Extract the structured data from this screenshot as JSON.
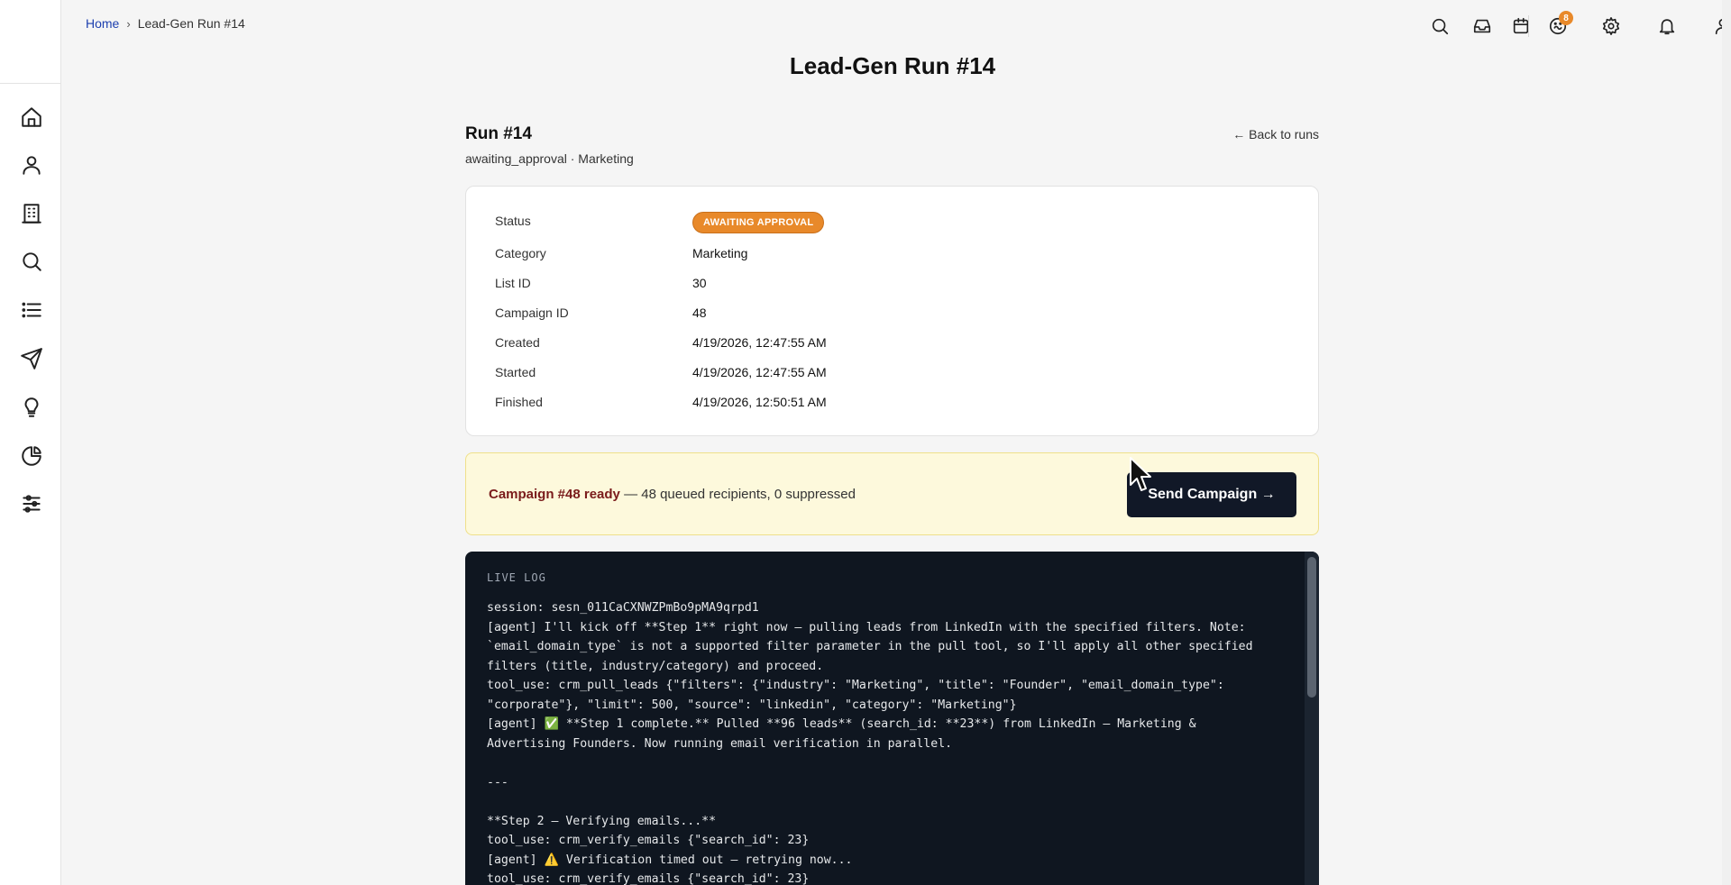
{
  "breadcrumb": {
    "home": "Home",
    "separator": "›",
    "current": "Lead-Gen Run #14"
  },
  "header": {
    "page_title": "Lead-Gen Run #14",
    "notification_count": "8"
  },
  "sidebar": {
    "items": [
      {
        "icon": "home-icon"
      },
      {
        "icon": "user-icon"
      },
      {
        "icon": "building-icon"
      },
      {
        "icon": "search-icon"
      },
      {
        "icon": "list-icon"
      },
      {
        "icon": "send-icon"
      },
      {
        "icon": "lightbulb-icon"
      },
      {
        "icon": "pie-chart-icon"
      },
      {
        "icon": "sliders-icon"
      }
    ]
  },
  "run": {
    "title": "Run #14",
    "subtitle": "awaiting_approval · Marketing",
    "back_label": "← Back to runs"
  },
  "details": {
    "status_label": "Status",
    "status_value": "AWAITING APPROVAL",
    "rows": [
      {
        "label": "Category",
        "value": "Marketing"
      },
      {
        "label": "List ID",
        "value": "30"
      },
      {
        "label": "Campaign ID",
        "value": "48"
      },
      {
        "label": "Created",
        "value": "4/19/2026, 12:47:55 AM"
      },
      {
        "label": "Started",
        "value": "4/19/2026, 12:47:55 AM"
      },
      {
        "label": "Finished",
        "value": "4/19/2026, 12:50:51 AM"
      }
    ]
  },
  "banner": {
    "strong": "Campaign #48 ready",
    "rest": " — 48 queued recipients, 0 suppressed",
    "button_label": "Send Campaign →"
  },
  "log": {
    "heading": "LIVE LOG",
    "lines": "session: sesn_011CaCXNWZPmBo9pMA9qrpd1\n[agent] I'll kick off **Step 1** right now — pulling leads from LinkedIn with the specified filters. Note: `email_domain_type` is not a supported filter parameter in the pull tool, so I'll apply all other specified filters (title, industry/category) and proceed.\ntool_use: crm_pull_leads {\"filters\": {\"industry\": \"Marketing\", \"title\": \"Founder\", \"email_domain_type\": \"corporate\"}, \"limit\": 500, \"source\": \"linkedin\", \"category\": \"Marketing\"}\n[agent] ✅ **Step 1 complete.** Pulled **96 leads** (search_id: **23**) from LinkedIn — Marketing & Advertising Founders. Now running email verification in parallel.\n\n---\n\n**Step 2 — Verifying emails...**\ntool_use: crm_verify_emails {\"search_id\": 23}\n[agent] ⚠️ Verification timed out — retrying now...\ntool_use: crm_verify_emails {\"search_id\": 23}"
  },
  "colors": {
    "accent": "#e8892a",
    "button": "#111827",
    "log_bg": "#0f1620",
    "banner_bg": "#fdf9dc"
  }
}
